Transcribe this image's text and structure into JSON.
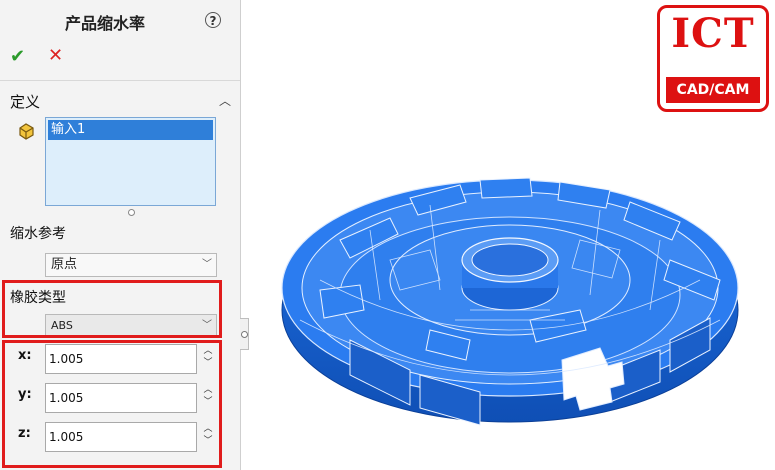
{
  "panel": {
    "title": "产品缩水率",
    "help_icon": "?",
    "ok_icon": "✔",
    "cancel_icon": "✕",
    "definition_section": "定义",
    "input_list": [
      "输入1"
    ],
    "shrink_reference_label": "缩水参考",
    "shrink_reference_value": "原点",
    "rubber_type_label": "橡胶类型",
    "rubber_type_value": "ABS",
    "x_label": "x:",
    "x_value": "1.005",
    "y_label": "y:",
    "y_value": "1.005",
    "z_label": "z:",
    "z_value": "1.005"
  },
  "logo": {
    "main": "ICT",
    "sub": "CAD/CAM"
  },
  "colors": {
    "model_fill": "#1f6fe0",
    "highlight_red": "#e01b1b",
    "selection_blue": "#2f7fd9"
  }
}
